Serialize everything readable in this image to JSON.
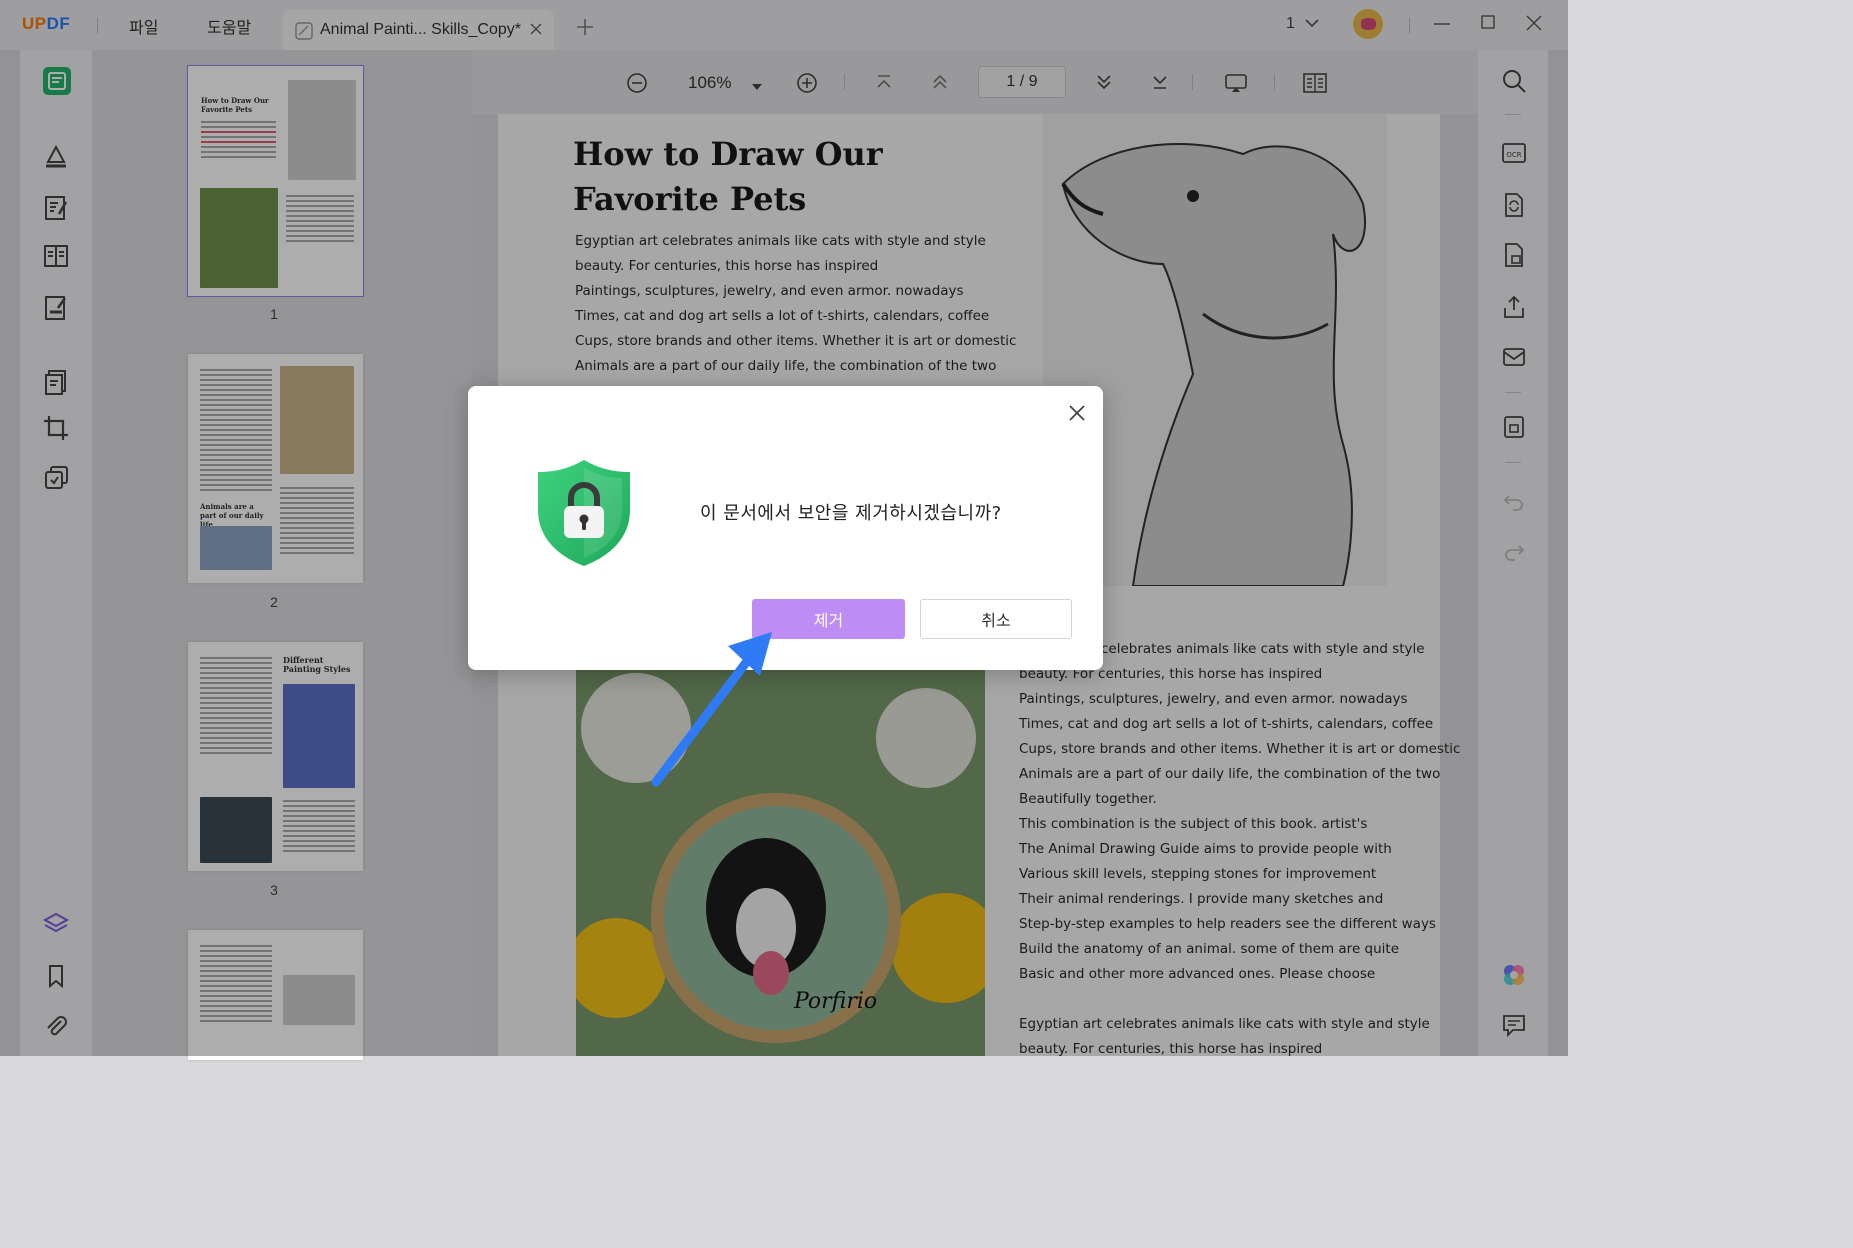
{
  "app": {
    "logo_u": "UP",
    "logo_df": "DF",
    "menu_file": "파일",
    "menu_help": "도움말",
    "tab_title": "Animal Painti... Skills_Copy*",
    "window_count": "1"
  },
  "toolbar": {
    "zoom": "106%",
    "page_indicator": "1 / 9"
  },
  "thumbnails": {
    "page_numbers": [
      "1",
      "2",
      "3"
    ],
    "page1_title": "How to Draw Our Favorite Pets",
    "page2_caption": "Animals are a part of our daily life",
    "page3_title": "Different Painting Styles"
  },
  "document": {
    "title_line1": "How to Draw Our",
    "title_line2": "Favorite Pets",
    "intro_lines": [
      "Egyptian art celebrates animals like cats with style and style",
      "beauty. For centuries, this horse has inspired",
      "Paintings, sculptures, jewelry, and even armor. nowadays",
      "Times, cat and dog art sells a lot of t-shirts, calendars, coffee",
      "Cups, store brands and other items. Whether it is art or domestic",
      "Animals are a part of our daily life, the combination of the two"
    ],
    "body_lines": [
      "celebrates animals like cats with style and style",
      "beauty. For centuries, this horse has inspired",
      "Paintings, sculptures, jewelry, and even armor. nowadays",
      "Times, cat and dog art sells a lot of t-shirts, calendars, coffee",
      "Cups, store brands and other items. Whether it is art or domestic",
      "Animals are a part of our daily life, the combination of the two",
      "Beautifully together.",
      "This combination is the subject of this book. artist's",
      "The Animal Drawing Guide aims to provide people with",
      "Various skill levels, stepping stones for improvement",
      "Their animal renderings. I provide many sketches and",
      "Step-by-step examples to help readers see the different ways",
      "Build the anatomy of an animal. some of them are quite",
      "Basic and other more advanced ones. Please choose"
    ],
    "footer_lines": [
      "Egyptian art celebrates animals like cats with style and style",
      "beauty. For centuries, this horse has inspired"
    ],
    "photo_signature": "Porfirio"
  },
  "dialog": {
    "message": "이 문서에서 보안을 제거하시겠습니까?",
    "remove_label": "제거",
    "cancel_label": "취소"
  },
  "colors": {
    "accent": "#be8cf5",
    "arrow": "#2f7bf5",
    "shield": "#2bbf6a"
  }
}
